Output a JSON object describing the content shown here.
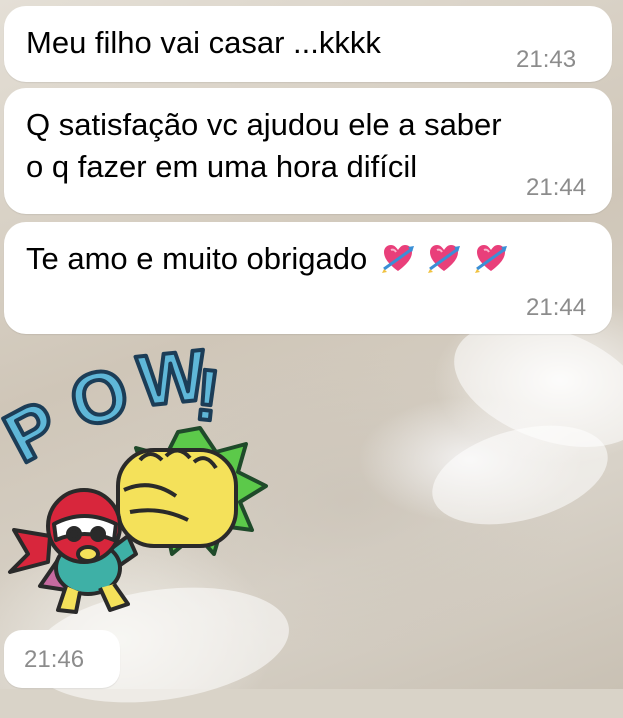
{
  "messages": [
    {
      "text": "Meu filho vai casar ...kkkk",
      "time": "21:43"
    },
    {
      "lines": [
        "Q satisfação vc ajudou ele a saber",
        "o q fazer em uma hora difícil"
      ],
      "time": "21:44"
    },
    {
      "text": "Te amo e muito obrigado",
      "emoji": [
        "heart-arrow",
        "heart-arrow",
        "heart-arrow"
      ],
      "time": "21:44"
    }
  ],
  "sticker": {
    "word": "POW!",
    "time": "21:46"
  },
  "colors": {
    "bubble": "#ffffff",
    "time_text": "#8c8c8c",
    "pow_blue": "#5fb7d8",
    "fist_yellow": "#f4e15a",
    "burst_green": "#5cc94a",
    "hero_red": "#d8263c"
  }
}
